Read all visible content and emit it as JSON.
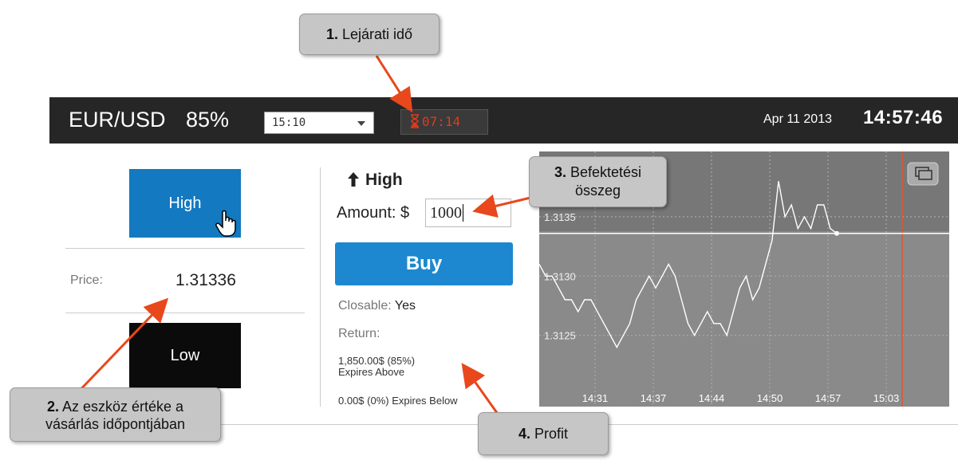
{
  "callouts": {
    "c1_num": "1.",
    "c1_text": "Lejárati idő",
    "c2_num": "2.",
    "c2_line1": "Az eszköz értéke a",
    "c2_line2": "vásárlás időpontjában",
    "c3_num": "3.",
    "c3_line1": "Befektetési",
    "c3_line2": "összeg",
    "c4_num": "4.",
    "c4_text": "Profit"
  },
  "topbar": {
    "asset": "EUR/USD",
    "payout": "85%",
    "expiry_value": "15:10",
    "countdown": "07:14",
    "date": "Apr 11 2013",
    "time": "14:57:46"
  },
  "left_panel": {
    "high_label": "High",
    "price_label": "Price:",
    "price_value": "1.31336",
    "low_label": "Low"
  },
  "middle_panel": {
    "direction_title": "High",
    "amount_label": "Amount: $",
    "amount_value": "1000",
    "buy_label": "Buy",
    "closable_label": "Closable:",
    "closable_value": "Yes",
    "return_label": "Return:",
    "return_above_line1": "1,850.00$ (85%)",
    "return_above_line2": "Expires Above",
    "return_below": "0.00$ (0%) Expires Below"
  },
  "chart_data": {
    "type": "line",
    "y_ticks": [
      "1.3135",
      "1.3130",
      "1.3125"
    ],
    "x_ticks": [
      "14:31",
      "14:37",
      "14:44",
      "14:50",
      "14:57",
      "15:03"
    ],
    "ylim": [
      1.3119,
      1.31405
    ],
    "current_price": 1.31336,
    "series": [
      {
        "values": [
          1.3131,
          1.313,
          1.313,
          1.3129,
          1.3128,
          1.3128,
          1.3127,
          1.3128,
          1.3128,
          1.3127,
          1.3126,
          1.3125,
          1.3124,
          1.3125,
          1.3126,
          1.3128,
          1.3129,
          1.313,
          1.3129,
          1.313,
          1.3131,
          1.313,
          1.3128,
          1.3126,
          1.3125,
          1.3126,
          1.3127,
          1.3126,
          1.3126,
          1.3125,
          1.3127,
          1.3129,
          1.313,
          1.3128,
          1.3129,
          1.3131,
          1.3133,
          1.3138,
          1.3135,
          1.3136,
          1.3134,
          1.3135,
          1.3134,
          1.3136,
          1.3136,
          1.3134,
          1.31336
        ]
      }
    ]
  }
}
